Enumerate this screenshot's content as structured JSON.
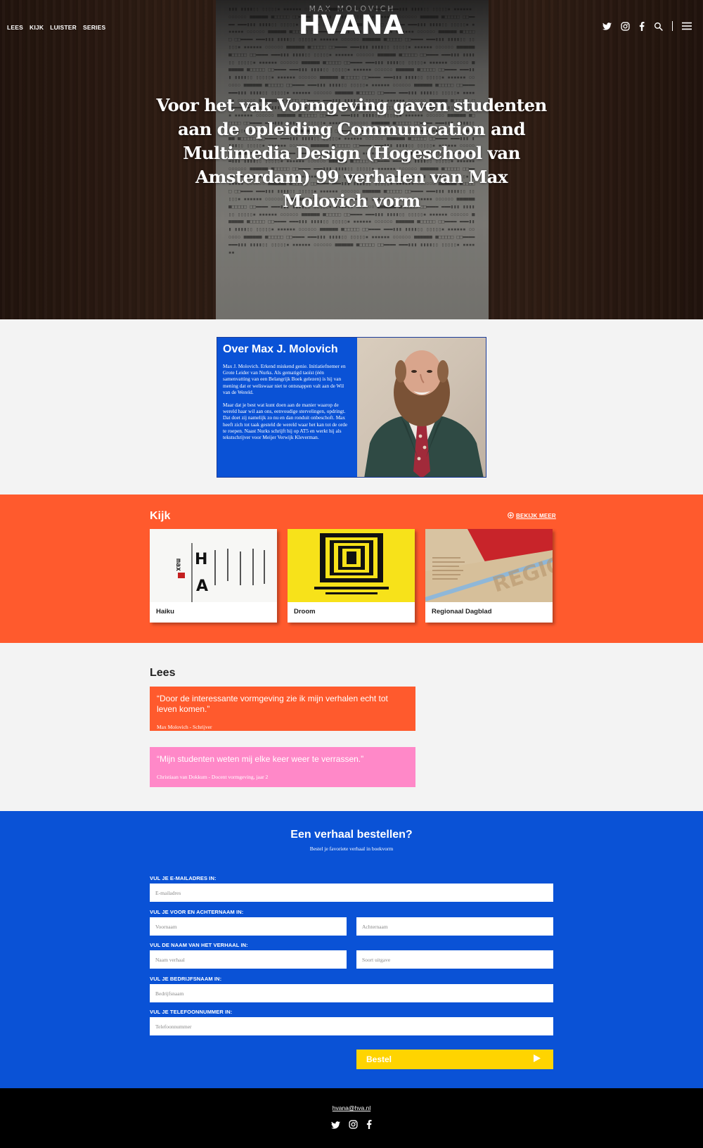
{
  "nav": {
    "links": [
      "LEES",
      "KIJK",
      "LUISTER",
      "SERIES"
    ],
    "logo": "HVANA",
    "icons": [
      "twitter-icon",
      "instagram-icon",
      "facebook-icon",
      "search-icon",
      "menu-icon"
    ]
  },
  "hero": {
    "paper_title": "MAX MOLOVICH",
    "title": "Voor het vak Vormgeving gaven studenten aan de opleiding Communication and Multimedia Design (Hogeschool van Amsterdam) 99 verhalen van Max Molovich vorm"
  },
  "about": {
    "title": "Over Max J. Molovich",
    "paragraph1": "Max J. Molovich. Erkend miskend genie. Initiatiefnemer en Grote Leider van Nurks. Als gematigd taoïst (één samenvatting van een Belangrijk Boek gelezen) is hij van mening dat er weliswaar niet te ontsnappen valt aan de Wil van de Wereld.",
    "paragraph2": "Maar dat je best wat kunt doen aan de manier waarop de wereld haar wil aan ons, eenvoudige stervelingen, opdringt. Dat doet zij namelijk zo nu en dan ronduit onbeschoft. Max heeft zich tot taak gesteld de wereld waar het kan tot de orde te roepen. Naast Nurks schrijft hij op AT5 en werkt hij als tekstschrijver voor Meijer Verwijk Kleverman."
  },
  "kijk": {
    "title": "Kijk",
    "more": "BEKIJK MEER",
    "cards": [
      {
        "label": "Haiku"
      },
      {
        "label": "Droom"
      },
      {
        "label": "Regionaal Dagblad"
      }
    ]
  },
  "lees": {
    "title": "Lees",
    "quotes": [
      {
        "text": "“Door de interessante vormgeving zie ik mijn verhalen echt tot leven komen.”",
        "author": "Max Molovich - Schrijver",
        "color": "#ff5a2d"
      },
      {
        "text": "“Mijn studenten weten mij elke keer weer te verrassen.”",
        "author": "Christiaan van Dokkum - Docent vormgeving, jaar 2",
        "color": "#ff88c8"
      }
    ]
  },
  "order": {
    "title": "Een verhaal bestellen?",
    "subtitle": "Bestel je favoriete verhaal in boekvorm",
    "email_label": "VUL JE E-MAILADRES IN:",
    "email_placeholder": "E-mailadres",
    "name_label": "VUL JE VOOR EN ACHTERNAAM IN:",
    "firstname_placeholder": "Voornaam",
    "lastname_placeholder": "Achternaam",
    "story_label": "VUL DE NAAM VAN HET VERHAAL IN:",
    "story_placeholder": "Naam verhaal",
    "edition_placeholder": "Soort uitgave",
    "company_label": "VUL JE BEDRIJFSNAAM IN:",
    "company_placeholder": "Bedrijfsnaam",
    "phone_label": "VUL JE TELEFOONNUMMER IN:",
    "phone_placeholder": "Telefoonnummer",
    "submit": "Bestel"
  },
  "footer": {
    "email": "hvana@hva.nl",
    "icons": [
      "twitter-icon",
      "instagram-icon",
      "facebook-icon"
    ]
  },
  "colors": {
    "orange": "#ff5a2d",
    "blue": "#0a52d6",
    "pink": "#ff88c8",
    "yellow": "#ffd400"
  }
}
